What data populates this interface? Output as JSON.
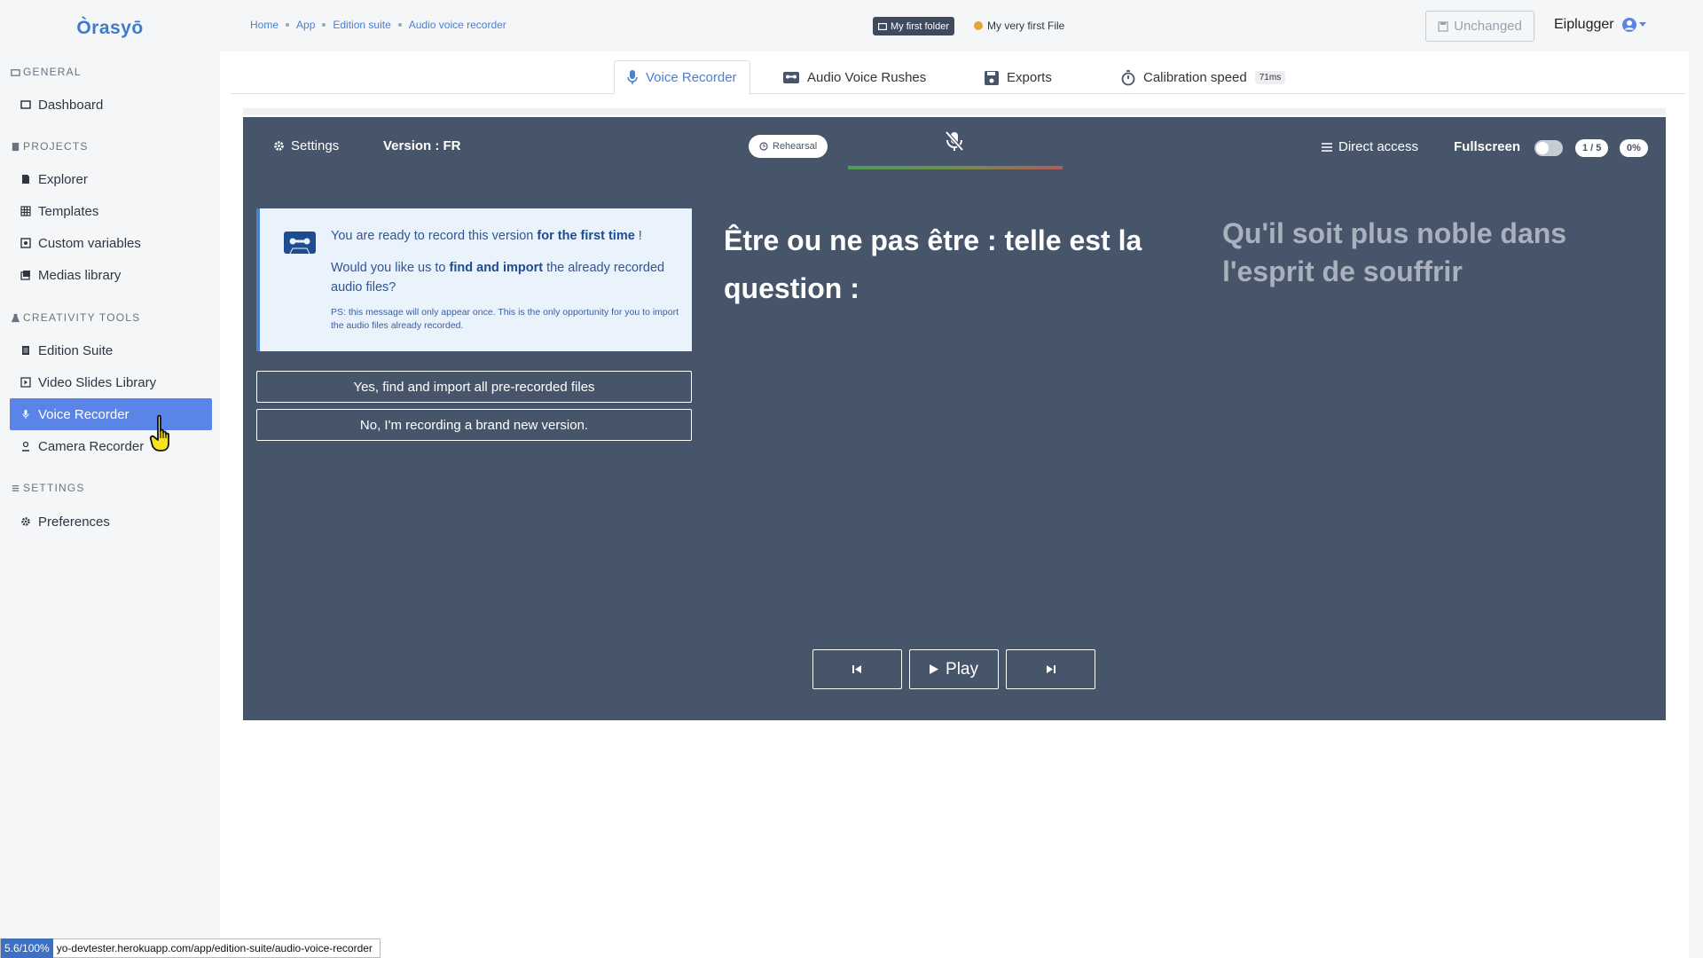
{
  "brand": "Òrasyō",
  "sidebar": {
    "sections": [
      {
        "title": "GENERAL",
        "items": [
          {
            "label": "Dashboard"
          }
        ]
      },
      {
        "title": "PROJECTS",
        "items": [
          {
            "label": "Explorer"
          },
          {
            "label": "Templates"
          },
          {
            "label": "Custom variables"
          },
          {
            "label": "Medias library"
          }
        ]
      },
      {
        "title": "CREATIVITY TOOLS",
        "items": [
          {
            "label": "Edition Suite"
          },
          {
            "label": "Video Slides Library"
          },
          {
            "label": "Voice Recorder"
          },
          {
            "label": "Camera Recorder"
          }
        ]
      },
      {
        "title": "SETTINGS",
        "items": [
          {
            "label": "Preferences"
          }
        ]
      }
    ],
    "active_item": "Voice Recorder"
  },
  "header": {
    "breadcrumbs": [
      "Home",
      "App",
      "Edition suite",
      "Audio voice recorder"
    ],
    "folder": "My first folder",
    "file": "My very first File",
    "save_status": "Unchanged",
    "username": "Eiplugger"
  },
  "tabs": [
    {
      "label": "Voice Recorder",
      "active": true
    },
    {
      "label": "Audio Voice Rushes",
      "active": false
    },
    {
      "label": "Exports",
      "active": false
    },
    {
      "label": "Calibration speed",
      "badge": "71ms",
      "active": false
    }
  ],
  "recorder": {
    "settings_label": "Settings",
    "version_label": "Version : FR",
    "rehearsal_label": "Rehearsal",
    "direct_access_label": "Direct access",
    "fullscreen_label": "Fullscreen",
    "fullscreen_on": false,
    "slide_counter": "1 / 5",
    "progress": "0%",
    "info": {
      "line1_pre": "You are ready to record this version ",
      "line1_bold": "for the first time",
      "line1_post": " !",
      "line2_pre": "Would you like us to ",
      "line2_bold": "find and import",
      "line2_post": " the already recorded audio files?",
      "ps": "PS: this message will only appear once. This is the only opportunity for you to import the audio files already recorded."
    },
    "import_button": "Yes, find and import all pre-recorded files",
    "new_button": "No, I'm recording a brand new version.",
    "current_text": "Être ou ne pas être : telle est la question :",
    "next_text": "Qu'il soit plus noble dans l'esprit de souffrir",
    "play_label": "Play"
  },
  "statusbar": {
    "zoom": "5.6/100%",
    "url": "yo-devtester.herokuapp.com/app/edition-suite/audio-voice-recorder"
  },
  "colors": {
    "accent": "#4a7fd1",
    "active_nav": "#5b84e8",
    "panel": "#47556a"
  }
}
